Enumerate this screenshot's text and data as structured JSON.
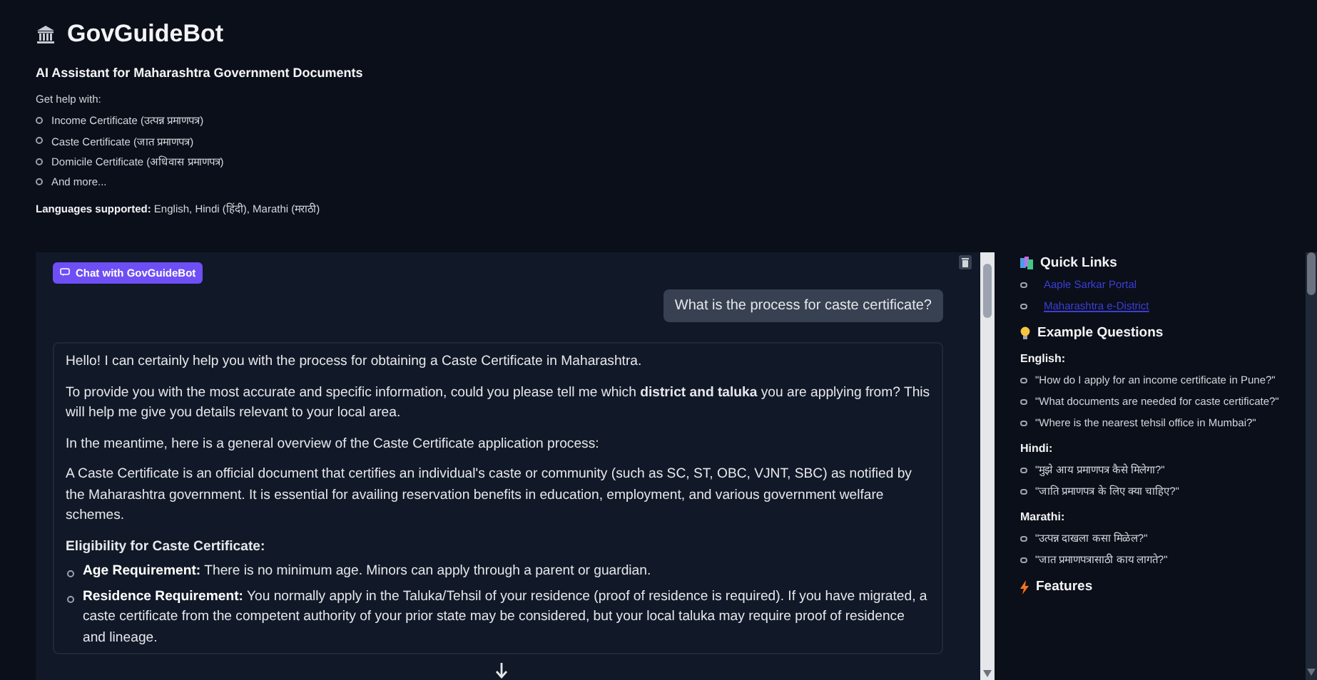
{
  "header": {
    "title": "GovGuideBot",
    "subtitle": "AI Assistant for Maharashtra Government Documents",
    "help_intro": "Get help with:",
    "help_items": [
      "Income Certificate (उत्पन्न प्रमाणपत्र)",
      "Caste Certificate (जात प्रमाणपत्र)",
      "Domicile Certificate (अधिवास प्रमाणपत्र)",
      "And more..."
    ],
    "languages": "**Languages supported:** English, Hindi (हिंदी), Marathi (मराठी)"
  },
  "chat": {
    "label": "Chat with GovGuideBot",
    "messages": [
      {
        "kind": "user",
        "text": "What is the process for caste certificate?"
      },
      {
        "kind": "bot",
        "blocks": [
          {
            "kind": "paragraph",
            "text": "Hello! I can certainly help you with the process for obtaining a Caste Certificate in Maharashtra."
          },
          {
            "kind": "paragraph",
            "text": "To provide you with the most accurate and specific information, could you please tell me which **district and taluka** you are applying from? This will help me give you details relevant to your local area."
          },
          {
            "kind": "paragraph",
            "text": "In the meantime, here is a general overview of the Caste Certificate application process:"
          },
          {
            "kind": "paragraph",
            "text": "A Caste Certificate is an official document that certifies an individual's caste or community (such as SC, ST, OBC, VJNT, SBC) as notified by the Maharashtra government. It is essential for availing reservation benefits in education, employment, and various government welfare schemes."
          },
          {
            "kind": "heading",
            "text": "Eligibility for Caste Certificate:"
          },
          {
            "kind": "bullet",
            "text": "**Age Requirement:** There is no minimum age. Minors can apply through a parent or guardian."
          },
          {
            "kind": "bullet",
            "text": "**Residence Requirement:** You normally apply in the Taluka/Tehsil of your residence (proof of residence is required). If you have migrated, a caste certificate from the competent authority of your prior state may be considered, but your local taluka may require proof of residence and lineage."
          }
        ]
      }
    ]
  },
  "sidebar": {
    "quick_links": {
      "title": "Quick Links",
      "links": [
        {
          "label": "Aaple Sarkar Portal",
          "underlined": false
        },
        {
          "label": "Maharashtra e-District",
          "underlined": true
        }
      ]
    },
    "examples": {
      "title": "Example Questions",
      "groups": [
        {
          "language": "English:",
          "questions": [
            "\"How do I apply for an income certificate in Pune?\"",
            "\"What documents are needed for caste certificate?\"",
            "\"Where is the nearest tehsil office in Mumbai?\""
          ]
        },
        {
          "language": "Hindi:",
          "questions": [
            "\"मुझे आय प्रमाणपत्र कैसे मिलेगा?\"",
            "\"जाति प्रमाणपत्र के लिए क्या चाहिए?\""
          ]
        },
        {
          "language": "Marathi:",
          "questions": [
            "\"उत्पन्न दाखला कसा मिळेल?\"",
            "\"जात प्रमाणपत्रासाठी काय लागते?\""
          ]
        }
      ]
    },
    "features": {
      "title": "Features"
    }
  }
}
